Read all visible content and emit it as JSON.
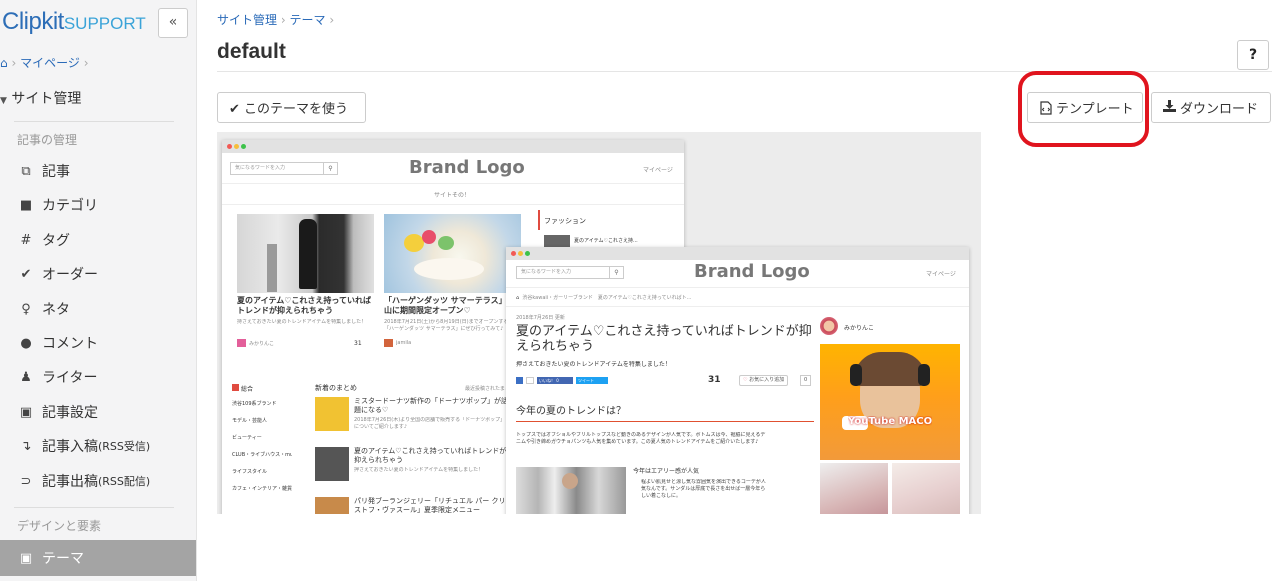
{
  "sidebar": {
    "logo_main": "Clipkit",
    "logo_sub": "SUPPORT",
    "collapse_label": "«",
    "breadcrumb": {
      "home_icon": "home-icon",
      "mypage": "マイページ",
      "sep": "›"
    },
    "site_admin": "サイト管理",
    "section_articles": "記事の管理",
    "items": [
      {
        "label": "記事",
        "icon": "copy-icon",
        "glyph": "⧉"
      },
      {
        "label": "カテゴリ",
        "icon": "folder-icon",
        "glyph": "■"
      },
      {
        "label": "タグ",
        "icon": "hashtag-icon",
        "glyph": "#"
      },
      {
        "label": "オーダー",
        "icon": "check-icon",
        "glyph": "✔"
      },
      {
        "label": "ネタ",
        "icon": "lightbulb-icon",
        "glyph": "♀"
      },
      {
        "label": "コメント",
        "icon": "comment-icon",
        "glyph": "●"
      },
      {
        "label": "ライター",
        "icon": "user-icon",
        "glyph": "♟"
      },
      {
        "label": "記事設定",
        "icon": "settings-file-icon",
        "glyph": "▣"
      },
      {
        "label": "記事入稿",
        "suffix": " (RSS受信)",
        "icon": "level-down-icon",
        "glyph": "↴"
      },
      {
        "label": "記事出稿",
        "suffix": " (RSS配信)",
        "icon": "rss-icon",
        "glyph": "⊃"
      }
    ],
    "section_design": "デザインと要素",
    "active_item": {
      "label": "テーマ",
      "icon": "theme-file-icon",
      "glyph": "▣"
    }
  },
  "main": {
    "breadcrumb": {
      "site_admin": "サイト管理",
      "theme": "テーマ",
      "sep": "›"
    },
    "title": "default",
    "help_label": "?",
    "use_theme_button": "✔ このテーマを使う",
    "template_button": "テンプレート",
    "download_button": "ダウンロード"
  },
  "preview": {
    "search_placeholder": "気になるワードを入力",
    "brand": "Brand Logo",
    "mypage": "マイページ",
    "site_tagline": "サイトその！",
    "back": {
      "fashion_heading": "ファッション",
      "fashion_item": "夏のアイテム♡これさえ持...",
      "card1_title": "夏のアイテム♡これさえ持っていればトレンドが抑えられちゃう",
      "card1_text": "持さえておきたい夏のトレンドアイテムを特集しました！",
      "card1_author": "みかりんこ",
      "card1_views": "31",
      "card2_title": "「ハーゲンダッツ サマーテラス」代官山に期間限定オープン♡",
      "card2_text": "2018年7月21日(土)から8月19日(日)までオープンする「ハーゲンダッツ サマーテラス」にぜひ行ってみて♪",
      "card2_author": "jamila",
      "nav_heading": "総合",
      "nav_items": [
        "渋谷109系ブランド",
        "モデル・芸能人",
        "ビューティー",
        "CLUB・ライブハウス・music",
        "ライフスタイル",
        "カフェ・インテリア・雑貨"
      ],
      "summary_heading": "新着のまとめ",
      "summary_note": "最近投稿されたまとめ",
      "list": [
        {
          "title": "ミスタードーナツ新作の「ドーナツポップ」が話題になる♡",
          "text": "2018年7月26日(木)より全国の店舗で販売する「ドーナツポップ」についてご紹介します♪"
        },
        {
          "title": "夏のアイテム♡これさえ持っていればトレンドが抑えられちゃう",
          "text": "押さえておきたい夏のトレンドアイテムを特集しました！"
        },
        {
          "title": "パリ発ブーランジェリー「リチュエル パー クリストフ・ヴァスール」夏季限定メニュー",
          "text": ""
        }
      ]
    },
    "front": {
      "breadcrumb": "渋谷kawaii・ガーリーブランド　夏のアイテム♡これさえ持っていればト...",
      "date": "2018年7月26日 更新",
      "title": "夏のアイテム♡これさえ持っていればトレンドが抑えられちゃう",
      "lead": "押さえておきたい夏のトレンドアイテムを特集しました！",
      "views": "31",
      "fav": "お気に入り追加",
      "fav_count": "0",
      "section_heading": "今年の夏のトレンドは？",
      "para": "トップスではオフショルやフリルトップスなど動きのあるデザインが人気です。ボトムスは今、裾脇に見えるデニムや引き締めガウチョパンツも人気を集めています。この夏人気のトレンドアイテムをご紹介いたします♪",
      "sub_heading": "今年はエアリー感が人気",
      "sub_text": "程よい肌見せと涼し気な雰囲気を演出できるコーデが人気なんです。サンダルは厚底で長さを出せば一層今年らしい着こなしに。",
      "author": "みかりんこ",
      "video_text": "YouTube MACO",
      "like_label": "いいね！ 0",
      "tweet_label": "ツイート"
    }
  }
}
